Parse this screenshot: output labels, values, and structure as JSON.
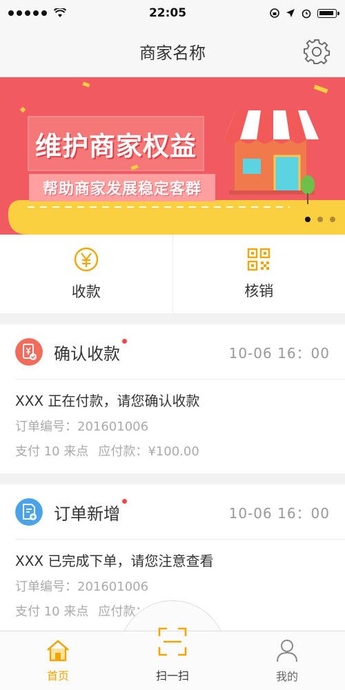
{
  "status_bar": {
    "time": "22:05"
  },
  "header": {
    "title": "商家名称",
    "settings_icon": "gear-icon"
  },
  "banner": {
    "title": "维护商家权益",
    "subtitle": "帮助商家发展稳定客群",
    "slide_count": 3,
    "active_slide": 1
  },
  "quick_actions": [
    {
      "label": "收款",
      "icon": "yen-circle-icon"
    },
    {
      "label": "核销",
      "icon": "qrcode-icon"
    }
  ],
  "notifications": [
    {
      "title": "确认收款",
      "time": "10-06 16：00",
      "message": "XXX 正在付款，请您确认收款",
      "order": "订单编号：201601006",
      "points": "支付 10 来点",
      "amount": "应付款：¥100.00",
      "icon": "payment-confirm-icon",
      "unread": true
    },
    {
      "title": "订单新增",
      "time": "10-06 16：00",
      "message": "XXX 已完成下单，请您注意查看",
      "order": "订单编号：201601006",
      "points": "支付 10 来点",
      "amount": "应付款：¥100.00",
      "icon": "new-order-icon",
      "unread": true
    }
  ],
  "tabbar": {
    "home": "首页",
    "scan": "扫一扫",
    "me": "我的",
    "active": "home"
  },
  "colors": {
    "banner": "#f25a62",
    "accent": "#f2a500",
    "confirm_icon": "#f26b5b",
    "order_icon": "#4aa3e8"
  }
}
